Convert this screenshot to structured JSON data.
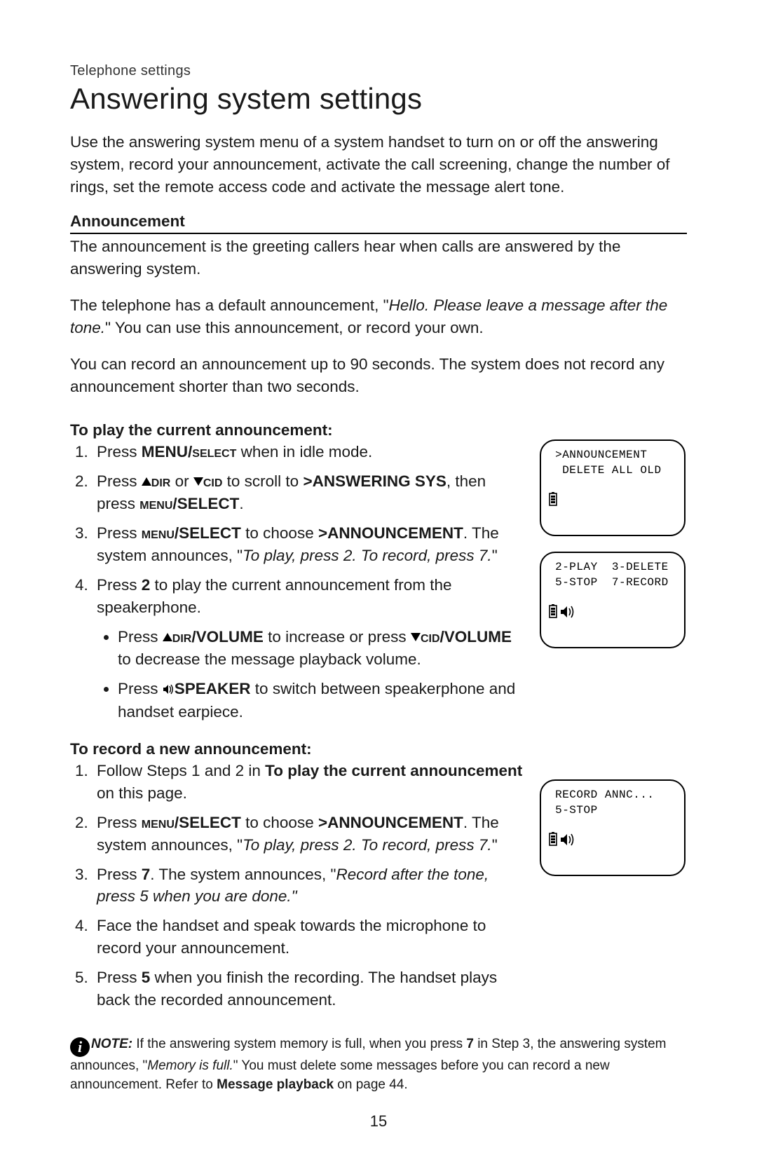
{
  "breadcrumb": "Telephone settings",
  "title": "Answering system settings",
  "intro": "Use the answering system menu of a system handset to turn on or off the answering system, record your announcement, activate the call screening, change the number of rings, set the remote access code and activate the message alert tone.",
  "section1": {
    "heading": "Announcement",
    "p1": "The announcement is the greeting callers hear when calls are answered by the answering system.",
    "p2_a": "The telephone has a default announcement, \"",
    "p2_i": "Hello. Please leave a message after the tone.",
    "p2_b": "\" You can use this announcement, or record your own.",
    "p3": "You can record an announcement up to 90 seconds. The system does not record any announcement shorter than two seconds."
  },
  "play": {
    "heading": "To play the current announcement:",
    "s1_a": "Press ",
    "s1_b": "MENU/",
    "s1_sc": "select",
    "s1_c": " when in idle mode.",
    "s2_a": "Press ",
    "s2_dir": "dir",
    "s2_b": " or ",
    "s2_cid": "cid",
    "s2_c": " to scroll to ",
    "s2_d": ">ANSWERING SYS",
    "s2_e": ", then press ",
    "s2_sc": "menu",
    "s2_f": "/SELECT",
    "s2_g": ".",
    "s3_a": "Press ",
    "s3_sc": "menu",
    "s3_b": "/SELECT",
    "s3_c": " to choose ",
    "s3_d": ">ANNOUNCEMENT",
    "s3_e": ". The system announces, \"",
    "s3_i": "To play, press 2. To record, press 7.",
    "s3_f": "\"",
    "s4_a": "Press ",
    "s4_b": "2",
    "s4_c": " to play the current announcement from the speakerphone.",
    "s4_sub1_a": "Press ",
    "s4_sub1_dir": "dir",
    "s4_sub1_b": "/VOLUME",
    "s4_sub1_c": " to increase or press ",
    "s4_sub1_cid": "cid",
    "s4_sub1_d": "/VOLUME",
    "s4_sub1_e": " to decrease the message playback volume.",
    "s4_sub2_a": "Press ",
    "s4_sub2_b": "SPEAKER",
    "s4_sub2_c": " to switch between speakerphone and handset earpiece."
  },
  "record": {
    "heading": "To record a new announcement:",
    "s1_a": "Follow Steps 1 and 2 in ",
    "s1_b": "To play the current announcement",
    "s1_c": " on this page.",
    "s2_a": "Press ",
    "s2_sc": "menu",
    "s2_b": "/SELECT",
    "s2_c": " to choose ",
    "s2_d": ">ANNOUNCEMENT",
    "s2_e": ". The system announces, \"",
    "s2_i": "To play, press 2. To record, press 7.",
    "s2_f": "\"",
    "s3_a": "Press ",
    "s3_b": "7",
    "s3_c": ". The system announces, \"",
    "s3_i": "Record after the tone, press 5 when you are done.\"",
    "s4": "Face the handset and speak towards the microphone to record your announcement.",
    "s5_a": "Press ",
    "s5_b": "5",
    "s5_c": " when you finish the recording. The handset plays back the recorded announcement."
  },
  "note": {
    "label": "NOTE:",
    "a": " If the answering system memory is full, when you press ",
    "b": "7",
    "c": " in Step 3, the answering system announces, \"",
    "i": "Memory is full.",
    "d": "\" You must delete some messages before you can record a new announcement. Refer to ",
    "e": "Message playback",
    "f": " on page 44."
  },
  "lcd1": {
    "l1": " >ANNOUNCEMENT",
    "l2": "  DELETE ALL OLD"
  },
  "lcd2": {
    "l1": " 2-PLAY  3-DELETE",
    "l2": " 5-STOP  7-RECORD"
  },
  "lcd3": {
    "l1": " RECORD ANNC...",
    "l2": " 5-STOP"
  },
  "pagenum": "15"
}
